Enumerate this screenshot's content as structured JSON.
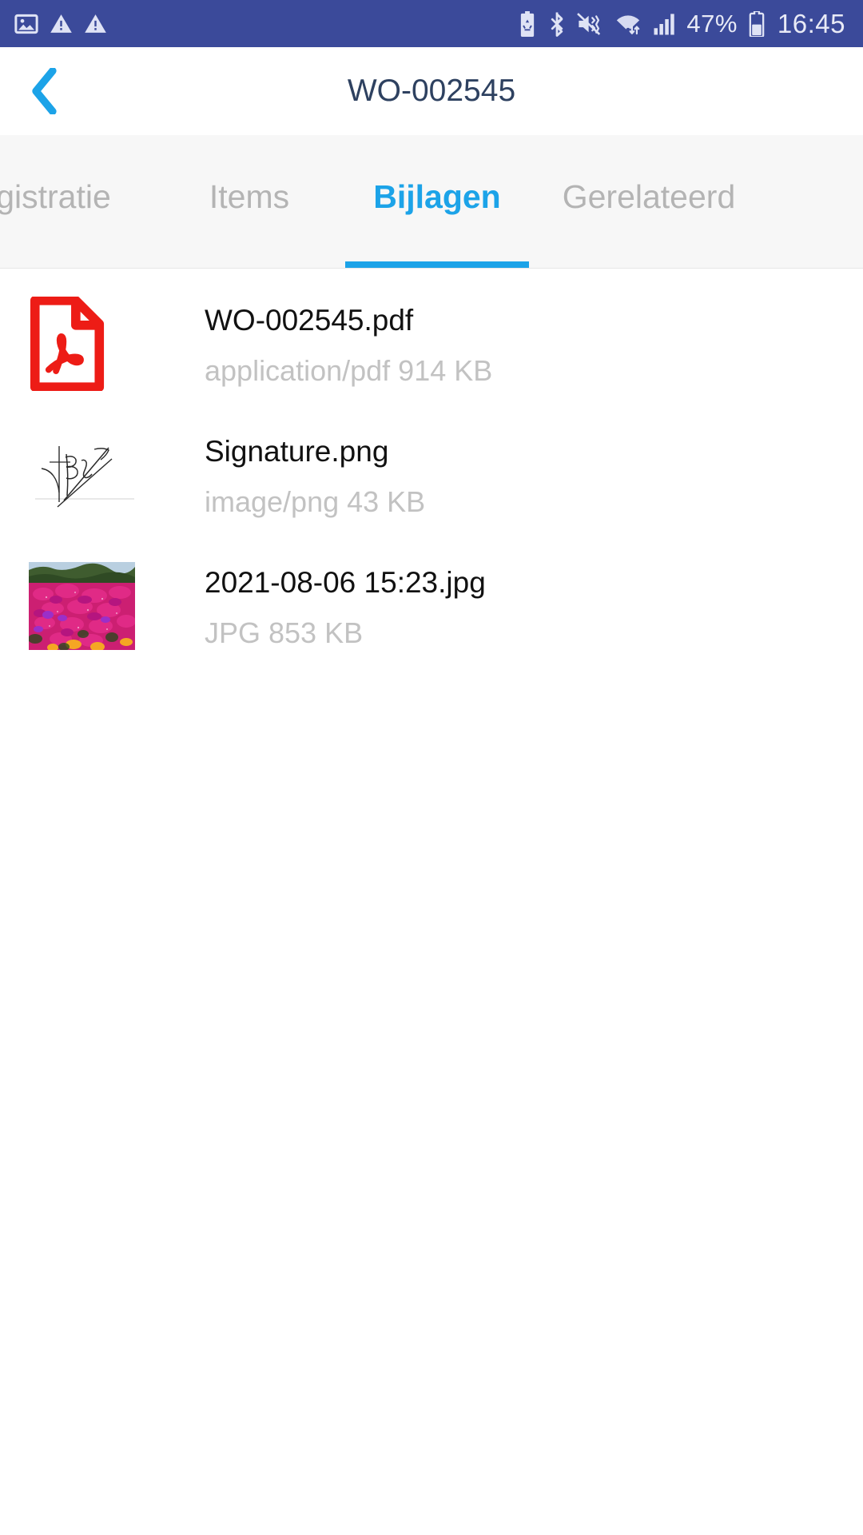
{
  "status_bar": {
    "left_icons": [
      "image-icon",
      "warning-triangle-icon",
      "warning-triangle-icon"
    ],
    "right_icons": [
      "power-saving-battery-icon",
      "bluetooth-icon",
      "vibrate-mute-icon",
      "wifi-icon",
      "cellular-signal-icon"
    ],
    "battery_percent": "47%",
    "time": "16:45",
    "background_color": "#3b4a9a",
    "foreground_color": "#e8eaf6"
  },
  "header": {
    "back_icon": "chevron-left-icon",
    "title": "WO-002545",
    "title_color": "#2e4160",
    "accent_color": "#1ca3e8"
  },
  "tabs": {
    "active_index": 2,
    "accent_color": "#1ca3e8",
    "inactive_color": "#b4b4b4",
    "items": [
      {
        "label": "gistratie",
        "name": "tab-registratie"
      },
      {
        "label": "Items",
        "name": "tab-items"
      },
      {
        "label": "Bijlagen",
        "name": "tab-bijlagen"
      },
      {
        "label": "Gerelateerd",
        "name": "tab-gerelateerd"
      }
    ]
  },
  "attachments": [
    {
      "name": "WO-002545.pdf",
      "meta": "application/pdf 914 KB",
      "thumb": "pdf-file-icon"
    },
    {
      "name": "Signature.png",
      "meta": "image/png 43 KB",
      "thumb": "signature-thumbnail"
    },
    {
      "name": "2021-08-06 15:23.jpg",
      "meta": "JPG 853 KB",
      "thumb": "photo-thumbnail"
    }
  ]
}
